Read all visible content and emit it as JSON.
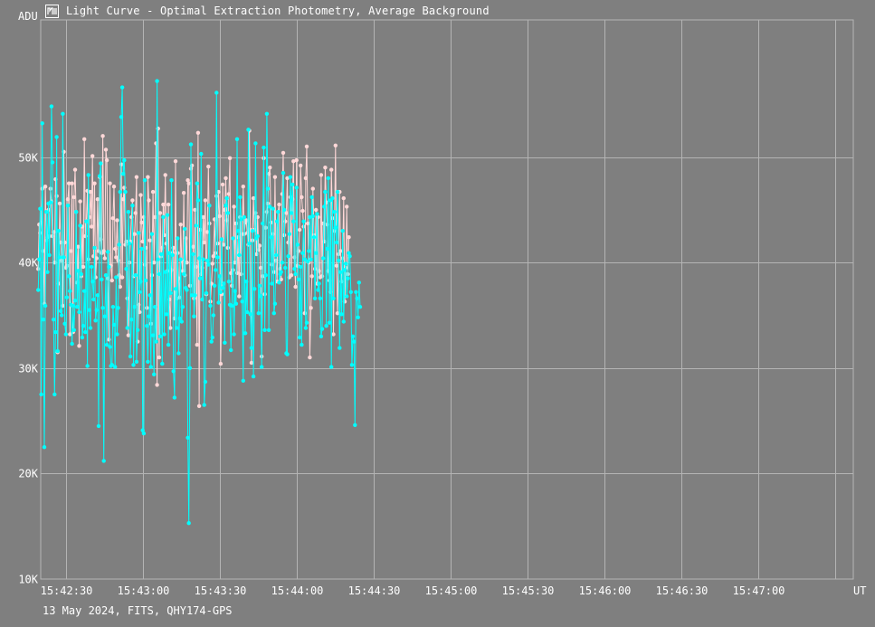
{
  "window": {
    "title": "Light Curve - Optimal Extraction Photometry, Average Background",
    "icon": "light-curve-app-icon"
  },
  "footer": {
    "caption": "13 May 2024, FITS, QHY174-GPS"
  },
  "colors": {
    "background": "#7f7f7f",
    "grid": "#b4b4b4",
    "target_series": "#00ffff",
    "comparison_series": "#ffd8d8"
  },
  "chart_data": {
    "type": "line",
    "title": "Light Curve - Optimal Extraction Photometry, Average Background",
    "xlabel": "UT",
    "ylabel": "ADU",
    "xlim": [
      "15:42:20",
      "15:47:37"
    ],
    "ylim": [
      10000,
      63000
    ],
    "x_tick_labels": [
      "15:42:30",
      "15:43:00",
      "15:43:30",
      "15:44:00",
      "15:44:30",
      "15:45:00",
      "15:45:30",
      "15:46:00",
      "15:46:30",
      "15:47:00"
    ],
    "y_tick_labels": [
      "10K",
      "20K",
      "30K",
      "40K",
      "50K"
    ],
    "y_ticks": [
      10000,
      20000,
      30000,
      40000,
      50000
    ],
    "grid": true,
    "legend": "none",
    "x_start": "15:42:19",
    "x_step_seconds": 0.4,
    "series": [
      {
        "color": "#00ffff",
        "values": [
          37400,
          40300,
          45100,
          27500,
          53200,
          34600,
          22500,
          35900,
          44800,
          39100,
          45600,
          40700,
          45700,
          54800,
          49500,
          34600,
          27500,
          33400,
          51900,
          31600,
          43000,
          40500,
          35400,
          35000,
          54100,
          40500,
          34200,
          33200,
          36700,
          45400,
          38700,
          37300,
          36000,
          32300,
          35900,
          33600,
          36400,
          44800,
          35800,
          39200,
          35300,
          43500,
          38900,
          32900,
          34000,
          37300,
          33400,
          43900,
          30200,
          48300,
          35500,
          33800,
          39600,
          38200,
          36500,
          41400,
          34500,
          35500,
          36900,
          24500,
          48200,
          49400,
          38400,
          35700,
          21200,
          34900,
          38800,
          32200,
          41000,
          39600,
          32000,
          30200,
          30300,
          35800,
          34100,
          30100,
          38600,
          33200,
          35700,
          41700,
          46700,
          53800,
          56600,
          48400,
          49700,
          46700,
          39400,
          33800,
          44800,
          41800,
          31100,
          34600,
          45400,
          30300,
          35800,
          38800,
          30600,
          33600,
          42800,
          37200,
          38200,
          41300,
          24100,
          23800,
          47800,
          38300,
          34000,
          30600,
          34900,
          36900,
          30100,
          42700,
          33100,
          29400,
          35800,
          32500,
          57200,
          40300,
          38900,
          33000,
          40800,
          30400,
          44300,
          33200,
          39100,
          35100,
          44500,
          32200,
          40900,
          37100,
          47800,
          40700,
          29700,
          27200,
          37500,
          33800,
          42300,
          31400,
          34700,
          40300,
          34400,
          35800,
          38900,
          43200,
          37600,
          37400,
          23400,
          15300,
          30000,
          51200,
          36900,
          40800,
          34900,
          36900,
          43500,
          47500,
          45900,
          40400,
          38500,
          50300,
          36500,
          40300,
          26500,
          28700,
          37100,
          40200,
          39800,
          45400,
          35900,
          32500,
          32900,
          35000,
          37800,
          39300,
          56100,
          40500,
          36200,
          38700,
          37200,
          42200,
          37600,
          38000,
          32400,
          45400,
          46100,
          44700,
          38200,
          36000,
          31700,
          35900,
          42300,
          33200,
          37300,
          36100,
          51700,
          43000,
          40700,
          46200,
          44100,
          36300,
          28800,
          44300,
          33300,
          38200,
          35300,
          52600,
          41800,
          35100,
          31900,
          43000,
          29200,
          37500,
          51300,
          42300,
          42500,
          35200,
          37800,
          36800,
          30100,
          43700,
          50900,
          33600,
          38800,
          54100,
          47000,
          33600,
          45300,
          42400,
          38000,
          45100,
          35200,
          36100,
          40700,
          43900,
          44800,
          38100,
          38900,
          39100,
          40000,
          48500,
          45000,
          39500,
          31400,
          31300,
          40600,
          42700,
          48100,
          44700,
          47400,
          43900,
          39400,
          38900,
          47100,
          41700,
          38400,
          32900,
          39600,
          32200,
          40900,
          43900,
          40300,
          33800,
          34300,
          40100,
          41100,
          44300,
          40300,
          46200,
          44400,
          42400,
          36600,
          40900,
          44600,
          37400,
          38000,
          36600,
          33000,
          33700,
          40400,
          45300,
          46700,
          34000,
          41300,
          48000,
          34300,
          45900,
          30100,
          46100,
          36600,
          44800,
          43300,
          41900,
          46700,
          40200,
          31900,
          39100,
          35100,
          43000,
          34400,
          39300,
          39900,
          36800,
          38500,
          40900,
          40600,
          37200,
          30300,
          33000,
          32500,
          24600,
          37200,
          36600,
          34800,
          38100,
          35800
        ]
      },
      {
        "color": "#ffd8d8",
        "values": [
          39400,
          43600,
          42800,
          43800,
          47000,
          41100,
          36100,
          47200,
          42100,
          42400,
          45000,
          42500,
          47000,
          45800,
          42500,
          42900,
          40000,
          47900,
          46300,
          31500,
          38000,
          45600,
          41900,
          40200,
          35900,
          50500,
          41900,
          39500,
          39700,
          46000,
          47500,
          33200,
          41100,
          47500,
          33400,
          46200,
          48800,
          44800,
          38100,
          41500,
          32100,
          45800,
          38700,
          43400,
          39600,
          51700,
          42500,
          43900,
          46800,
          40300,
          44300,
          46700,
          43400,
          50100,
          40600,
          47500,
          38600,
          40400,
          46000,
          41100,
          48100,
          42200,
          40900,
          52000,
          41100,
          40400,
          50700,
          49700,
          38500,
          32700,
          47500,
          39700,
          38300,
          44200,
          47200,
          41300,
          40500,
          44000,
          40200,
          38800,
          37700,
          49300,
          38600,
          46000,
          47100,
          41700,
          42000,
          36600,
          33100,
          40000,
          42000,
          44300,
          45900,
          38700,
          42700,
          44700,
          48100,
          32500,
          36000,
          35300,
          46400,
          43800,
          42000,
          44300,
          39800,
          41400,
          35700,
          48100,
          45900,
          42100,
          34200,
          38800,
          46700,
          40000,
          44300,
          51300,
          28400,
          52700,
          31000,
          44700,
          40600,
          41400,
          45500,
          42600,
          48300,
          41800,
          39200,
          45500,
          36500,
          33800,
          39300,
          40900,
          41400,
          34700,
          49600,
          36600,
          40900,
          38500,
          36700,
          43600,
          40200,
          39200,
          46600,
          38800,
          42300,
          40000,
          47800,
          47500,
          37800,
          48900,
          49200,
          41500,
          36600,
          45000,
          39600,
          32200,
          52300,
          26400,
          43100,
          38900,
          39500,
          44300,
          41900,
          45900,
          37000,
          42900,
          49100,
          43700,
          36300,
          38000,
          39900,
          40600,
          44100,
          40900,
          46300,
          41800,
          46700,
          44400,
          30400,
          37000,
          47400,
          41700,
          45000,
          48000,
          44000,
          41400,
          46500,
          49900,
          39000,
          37800,
          39300,
          45300,
          40000,
          43700,
          39000,
          42400,
          36800,
          44300,
          38900,
          42700,
          47200,
          42700,
          43800,
          44000,
          42800,
          41700,
          52500,
          43100,
          30500,
          42100,
          46100,
          43100,
          44700,
          40800,
          44300,
          41200,
          41600,
          39500,
          31100,
          38700,
          49900,
          37000,
          43300,
          44800,
          45600,
          48400,
          49000,
          43800,
          39800,
          42700,
          39100,
          48100,
          40200,
          38200,
          44800,
          45500,
          39400,
          38400,
          46500,
          50400,
          42600,
          43900,
          44700,
          48000,
          41900,
          38600,
          46200,
          38800,
          46000,
          49600,
          40500,
          37700,
          49700,
          39700,
          41100,
          43100,
          49200,
          46200,
          44900,
          43400,
          35200,
          48000,
          51000,
          43700,
          40000,
          31000,
          35700,
          38700,
          47000,
          42600,
          39400,
          45000,
          38000,
          44300,
          39200,
          38600,
          48300,
          38700,
          43700,
          42000,
          49000,
          45700,
          43600,
          39200,
          38300,
          37200,
          48800,
          44200,
          33200,
          43000,
          51100,
          39700,
          35200,
          40800,
          46700,
          41100,
          38200,
          40400,
          46100,
          36300,
          39500,
          45300,
          38900,
          42400
        ]
      }
    ]
  }
}
